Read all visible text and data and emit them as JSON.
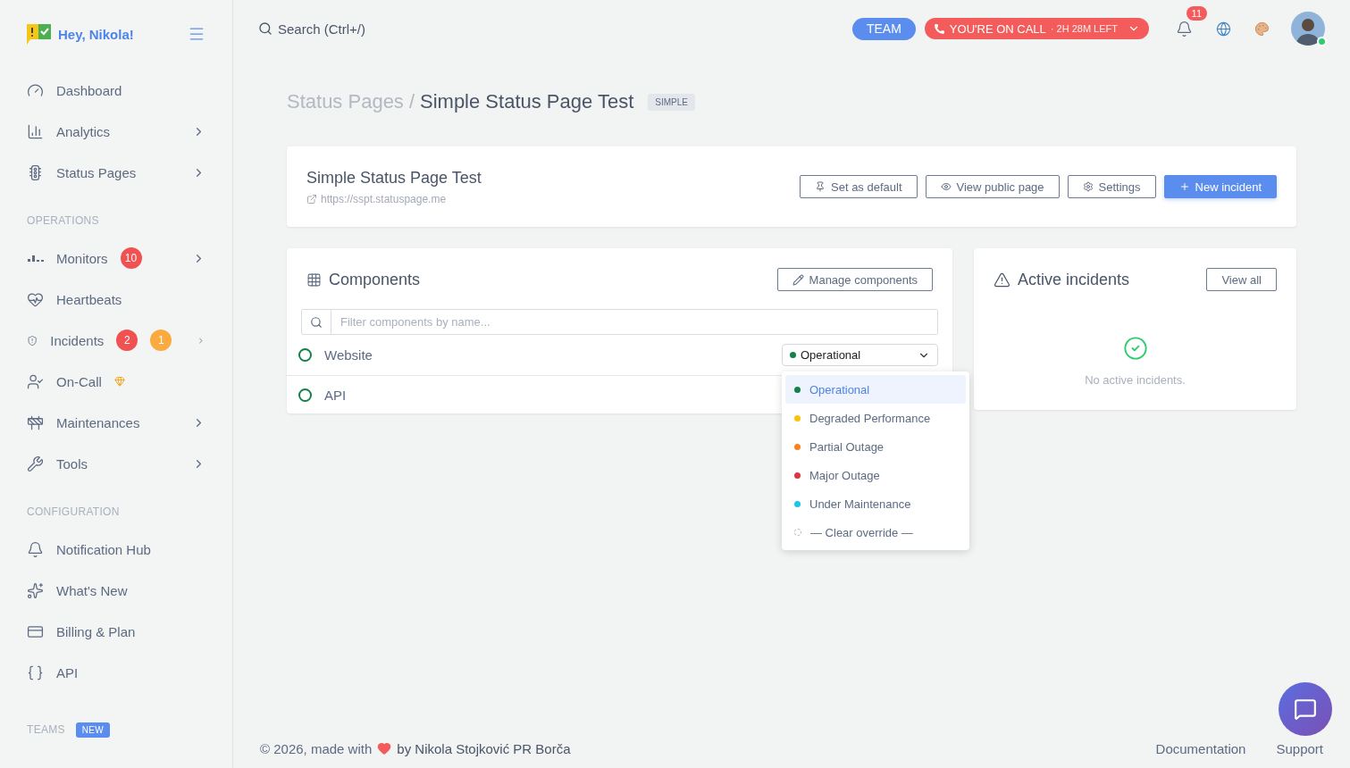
{
  "sidebar": {
    "greeting": "Hey, Nikola!",
    "sections": [
      {
        "items": [
          {
            "label": "Dashboard",
            "chevron": false
          },
          {
            "label": "Analytics",
            "chevron": true
          },
          {
            "label": "Status Pages",
            "chevron": true
          }
        ]
      },
      {
        "heading": "OPERATIONS",
        "items": [
          {
            "label": "Monitors",
            "chevron": true,
            "badges": [
              {
                "text": "10",
                "color": "#f05252"
              }
            ]
          },
          {
            "label": "Heartbeats",
            "chevron": false
          },
          {
            "label": "Incidents",
            "chevron": true,
            "badges": [
              {
                "text": "2",
                "color": "#f05252"
              },
              {
                "text": "1",
                "color": "#fbaa3f"
              }
            ]
          },
          {
            "label": "On-Call",
            "chevron": false,
            "premium": true
          },
          {
            "label": "Maintenances",
            "chevron": true
          },
          {
            "label": "Tools",
            "chevron": true
          }
        ]
      },
      {
        "heading": "CONFIGURATION",
        "items": [
          {
            "label": "Notification Hub",
            "chevron": false
          },
          {
            "label": "What's New",
            "chevron": false
          },
          {
            "label": "Billing & Plan",
            "chevron": false
          },
          {
            "label": "API",
            "chevron": false
          }
        ]
      }
    ],
    "teams": {
      "heading": "TEAMS",
      "badge": "NEW"
    }
  },
  "topbar": {
    "search_placeholder": "Search (Ctrl+/)",
    "team_button": "TEAM",
    "on_call": {
      "label": "YOU'RE ON CALL",
      "time": "· 2H 28M LEFT"
    },
    "notifications": "11",
    "avatar_online": true
  },
  "breadcrumb": {
    "parent": "Status Pages",
    "separator": "/",
    "current": "Simple Status Page Test",
    "tag": "SIMPLE"
  },
  "status_page": {
    "title": "Simple Status Page Test",
    "url": "https://sspt.statuspage.me",
    "buttons": [
      {
        "label": "Set as default",
        "primary": false
      },
      {
        "label": "View public page",
        "primary": false
      },
      {
        "label": "Settings",
        "primary": false
      },
      {
        "label": "New incident",
        "primary": true
      }
    ]
  },
  "components": {
    "title": "Components",
    "manage_button": "Manage components",
    "filter_placeholder": "Filter components by name...",
    "rows": [
      {
        "name": "Website",
        "select": {
          "value": "Operational",
          "color": "#14804a",
          "open": true
        }
      },
      {
        "name": "API"
      }
    ],
    "dropdown_options": [
      {
        "label": "Operational",
        "color": "#14804a",
        "selected": true,
        "kind": "status"
      },
      {
        "label": "Degraded Performance",
        "color": "#fbc20d",
        "selected": false,
        "kind": "status"
      },
      {
        "label": "Partial Outage",
        "color": "#fb8124",
        "selected": false,
        "kind": "status"
      },
      {
        "label": "Major Outage",
        "color": "#dc3545",
        "selected": false,
        "kind": "status"
      },
      {
        "label": "Under Maintenance",
        "color": "#1ec4ee",
        "selected": false,
        "kind": "status"
      },
      {
        "label": "— Clear override —",
        "selected": false,
        "kind": "clear"
      }
    ]
  },
  "incidents": {
    "title": "Active incidents",
    "view_all": "View all",
    "empty_text": "No active incidents."
  },
  "footer": {
    "prefix": "© 2026, made with",
    "author": "by Nikola Stojković PR Borča",
    "links": [
      "Documentation",
      "Support"
    ]
  }
}
